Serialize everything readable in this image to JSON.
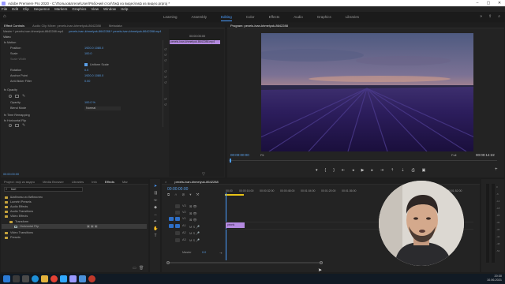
{
  "window": {
    "title": "Adobe Premiere Pro 2020 - C:\\Пользователи\\User\\Рабочий стол\\Гиф из видео\\гиф из видео.prproj *"
  },
  "menu": [
    "File",
    "Edit",
    "Clip",
    "Sequence",
    "Markers",
    "Graphics",
    "View",
    "Window",
    "Help"
  ],
  "workspaces": {
    "tabs": [
      "Learning",
      "Assembly",
      "Editing",
      "Color",
      "Effects",
      "Audio",
      "Graphics",
      "Libraries"
    ],
    "active": "Editing"
  },
  "effect_controls": {
    "tabs": [
      "Effect Controls",
      "Audio Clip Mixer: pexels-ivan-khmelyuk-8642288",
      "Metadata"
    ],
    "source_line": "Master * pexels-ivan-khmelyuk-8642288.mp4",
    "clip_line": "pexels-ivan-khmelyuk-8642288 * pexels-ivan-khmelyuk-8642288.mp4",
    "video_label": "Video",
    "mini_timecode": "00:00:05:00",
    "mini_clip": "pexels-ivan-khmelyuk-8642288.mp4",
    "rows": [
      {
        "label": "fx  Motion",
        "value": ""
      },
      {
        "label": "Position",
        "value": "1920.0  1080.0"
      },
      {
        "label": "Scale",
        "value": "100.0"
      },
      {
        "label": "Scale Width",
        "value": ""
      },
      {
        "label": "Uniform Scale",
        "value": ""
      },
      {
        "label": "Rotation",
        "value": "0.0"
      },
      {
        "label": "Anchor Point",
        "value": "1920.0  1080.0"
      },
      {
        "label": "Anti-flicker Filter",
        "value": "0.00"
      },
      {
        "label": "fx  Opacity",
        "value": ""
      },
      {
        "label": "Opacity",
        "value": "100.0 %"
      },
      {
        "label": "Blend Mode",
        "value": "Normal"
      },
      {
        "label": "fx  Time Remapping",
        "value": ""
      },
      {
        "label": "fx  Horizontal Flip",
        "value": ""
      }
    ],
    "bottom_timecode": "00:00:00:00"
  },
  "program_monitor": {
    "title": "Program: pexels-ivan-khmelyuk-8642288",
    "current_time": "00:00:00:00",
    "fit": "Fit",
    "quality": "Full",
    "duration": "00:00:14:22"
  },
  "project_panel": {
    "tabs": [
      "Project: гиф из видео",
      "Media Browser",
      "Libraries",
      "Info",
      "Effects",
      "Mar"
    ],
    "search_value": "hori",
    "items": [
      {
        "label": "Шаблоны из библиотек",
        "indent": 0
      },
      {
        "label": "Lumetri Presets",
        "indent": 0
      },
      {
        "label": "Audio Effects",
        "indent": 0
      },
      {
        "label": "Audio Transitions",
        "indent": 0
      },
      {
        "label": "Video Effects",
        "indent": 0
      },
      {
        "label": "Transform",
        "indent": 1
      },
      {
        "label": "Horizontal Flip",
        "indent": 2
      },
      {
        "label": "Video Transitions",
        "indent": 0
      },
      {
        "label": "Presets",
        "indent": 0
      }
    ]
  },
  "timeline": {
    "tab": "pexels-ivan-khmelyuk-8642288",
    "timecode": "00:00:00:00",
    "ruler": [
      "00:00",
      "00:00:16:00",
      "00:00:32:00",
      "00:00:48:00",
      "00:01:04:00",
      "00:01:20:00",
      "00:01:36:00",
      "00:01:52:00"
    ],
    "video_tracks": [
      "V3",
      "V2",
      "V1"
    ],
    "audio_tracks": [
      "A1",
      "A2",
      "A3"
    ],
    "master_label": "Master",
    "master_value": "0.0",
    "clip_label": "pexels"
  },
  "taskbar": {
    "time": "20:30",
    "date": "10.06.2021"
  },
  "colors": {
    "accent": "#4a9dff",
    "clip": "#b48ae0",
    "timeline_bar": "#e8c316"
  }
}
